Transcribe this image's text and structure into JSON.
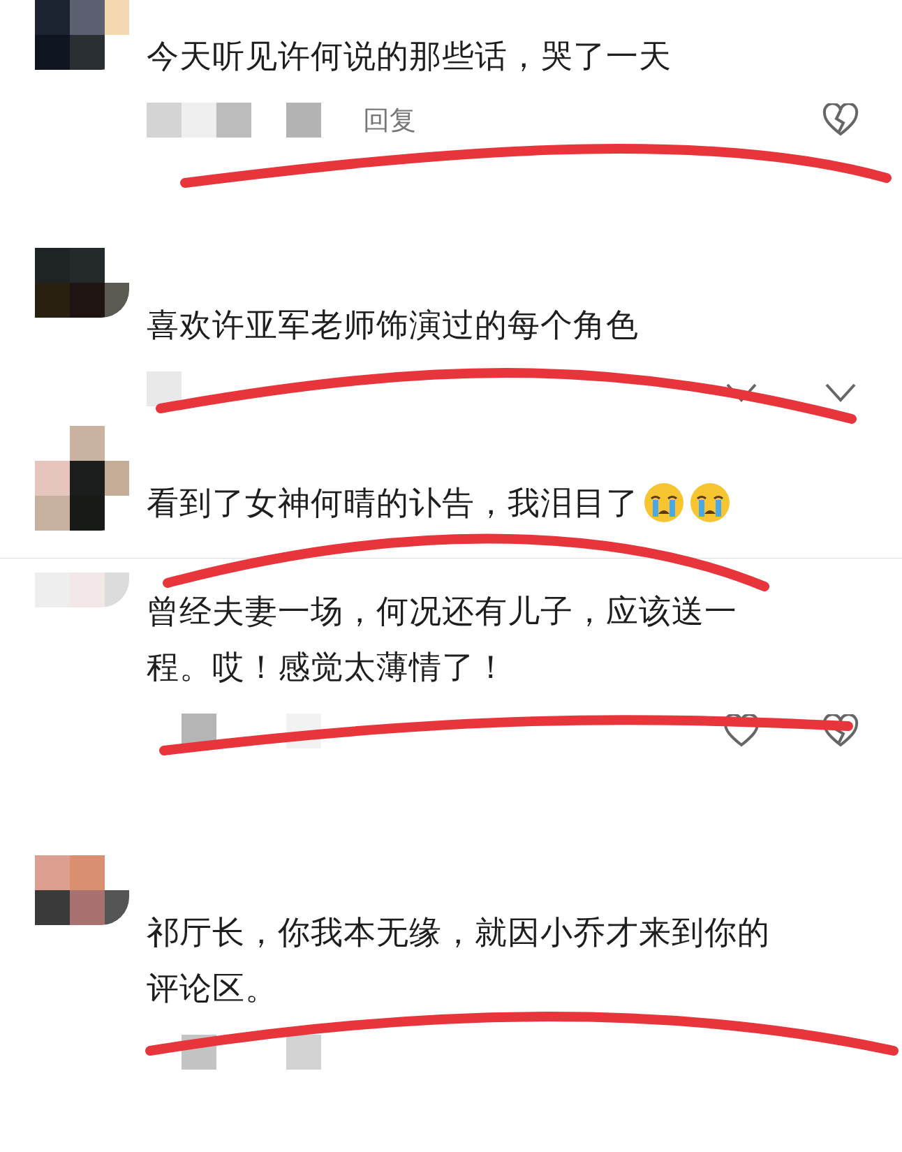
{
  "comments": [
    {
      "text": "今天听见许何说的那些话，哭了一天",
      "reply": "回复",
      "actions": [
        {
          "kind": "broken-heart"
        }
      ]
    },
    {
      "text": "喜欢许亚军老师饰演过的每个角色",
      "actions": [
        {
          "kind": "chevron"
        },
        {
          "kind": "chevron"
        }
      ]
    },
    {
      "text": "看到了女神何晴的讣告，我泪目了",
      "emojis": [
        {
          "kind": "crying"
        },
        {
          "kind": "crying"
        }
      ]
    },
    {
      "lines": [
        "曾经夫妻一场，何况还有儿子，应该送一",
        "程。哎！感觉太薄情了！"
      ],
      "actions": [
        {
          "kind": "heart"
        },
        {
          "kind": "broken-heart"
        }
      ]
    },
    {
      "lines": [
        "祁厅长，你我本无缘，就因小乔才来到你的",
        "评论区。"
      ]
    }
  ]
}
